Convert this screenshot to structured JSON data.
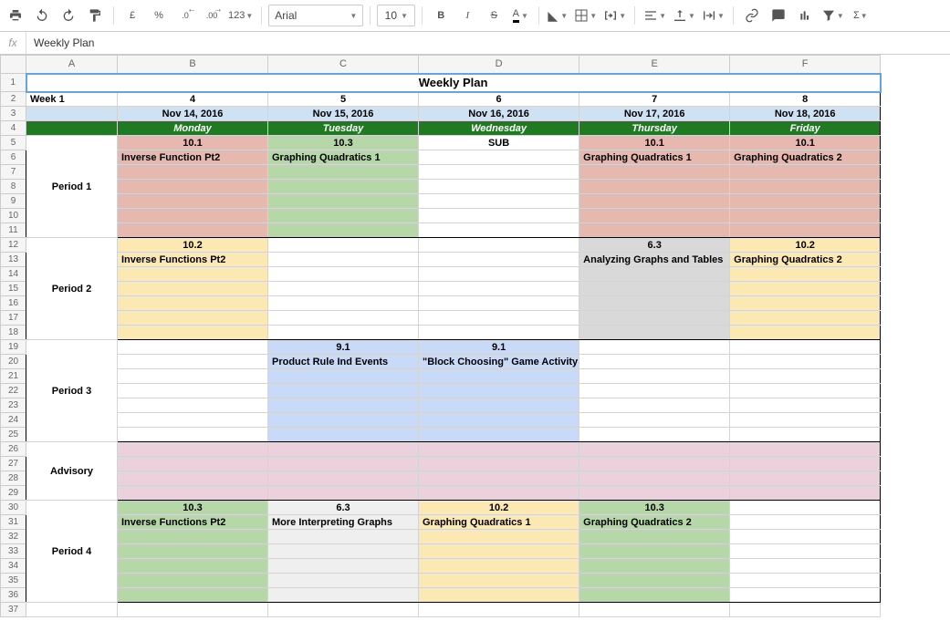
{
  "toolbar": {
    "font": "Arial",
    "size": "10",
    "currency_alt": "£",
    "percent": "%",
    "dec_minus": ".0",
    "dec_plus": ".00",
    "fmt123": "123",
    "bold": "B",
    "italic": "I",
    "strike": "S",
    "text_color": "A",
    "sigma": "Σ"
  },
  "formula": "Weekly Plan",
  "columns": [
    "A",
    "B",
    "C",
    "D",
    "E",
    "F"
  ],
  "rows": [
    "1",
    "2",
    "3",
    "4",
    "5",
    "6",
    "7",
    "8",
    "9",
    "10",
    "11",
    "12",
    "13",
    "14",
    "15",
    "16",
    "17",
    "18",
    "19",
    "20",
    "21",
    "22",
    "23",
    "24",
    "25",
    "26",
    "27",
    "28",
    "29",
    "30",
    "31",
    "32",
    "33",
    "34",
    "35",
    "36",
    "37"
  ],
  "sheet": {
    "title": "Weekly Plan",
    "week_label": "Week 1",
    "week_indices": [
      "4",
      "5",
      "6",
      "7",
      "8"
    ],
    "dates": [
      "Nov 14, 2016",
      "Nov 15, 2016",
      "Nov 16, 2016",
      "Nov 17, 2016",
      "Nov 18, 2016"
    ],
    "days": [
      "Monday",
      "Tuesday",
      "Wednesday",
      "Thursday",
      "Friday"
    ],
    "periods": {
      "p1": {
        "label": "Period 1",
        "row1": [
          "10.1",
          "10.3",
          "SUB",
          "10.1",
          "10.1"
        ],
        "row2": [
          "Inverse Function Pt2",
          "Graphing Quadratics 1",
          "",
          "Graphing Quadratics 1",
          "Graphing Quadratics 2"
        ],
        "colors": [
          "red",
          "green",
          "white",
          "red",
          "red"
        ]
      },
      "p2": {
        "label": "Period 2",
        "row1": [
          "10.2",
          "",
          "",
          "6.3",
          "10.2"
        ],
        "row2": [
          "Inverse Functions Pt2",
          "",
          "",
          "Analyzing Graphs and Tables",
          "Graphing Quadratics 2"
        ],
        "colors": [
          "yellow",
          "white",
          "white",
          "greyh",
          "yellow"
        ]
      },
      "p3": {
        "label": "Period 3",
        "row1": [
          "",
          "9.1",
          "9.1",
          "",
          ""
        ],
        "row2": [
          "",
          "Product Rule Ind Events",
          "\"Block Choosing\" Game Activity",
          "",
          ""
        ],
        "colors": [
          "white",
          "blue",
          "blue",
          "white",
          "white"
        ]
      },
      "adv": {
        "label": "Advisory",
        "colors": [
          "pink",
          "pink",
          "pink",
          "pink",
          "pink"
        ]
      },
      "p4": {
        "label": "Period 4",
        "row1": [
          "10.3",
          "6.3",
          "10.2",
          "10.3",
          ""
        ],
        "row2": [
          "Inverse Functions Pt2",
          "More Interpreting Graphs",
          "Graphing Quadratics 1",
          "Graphing Quadratics 2",
          ""
        ],
        "colors": [
          "green",
          "grey",
          "yellow",
          "green",
          "white"
        ]
      }
    }
  }
}
